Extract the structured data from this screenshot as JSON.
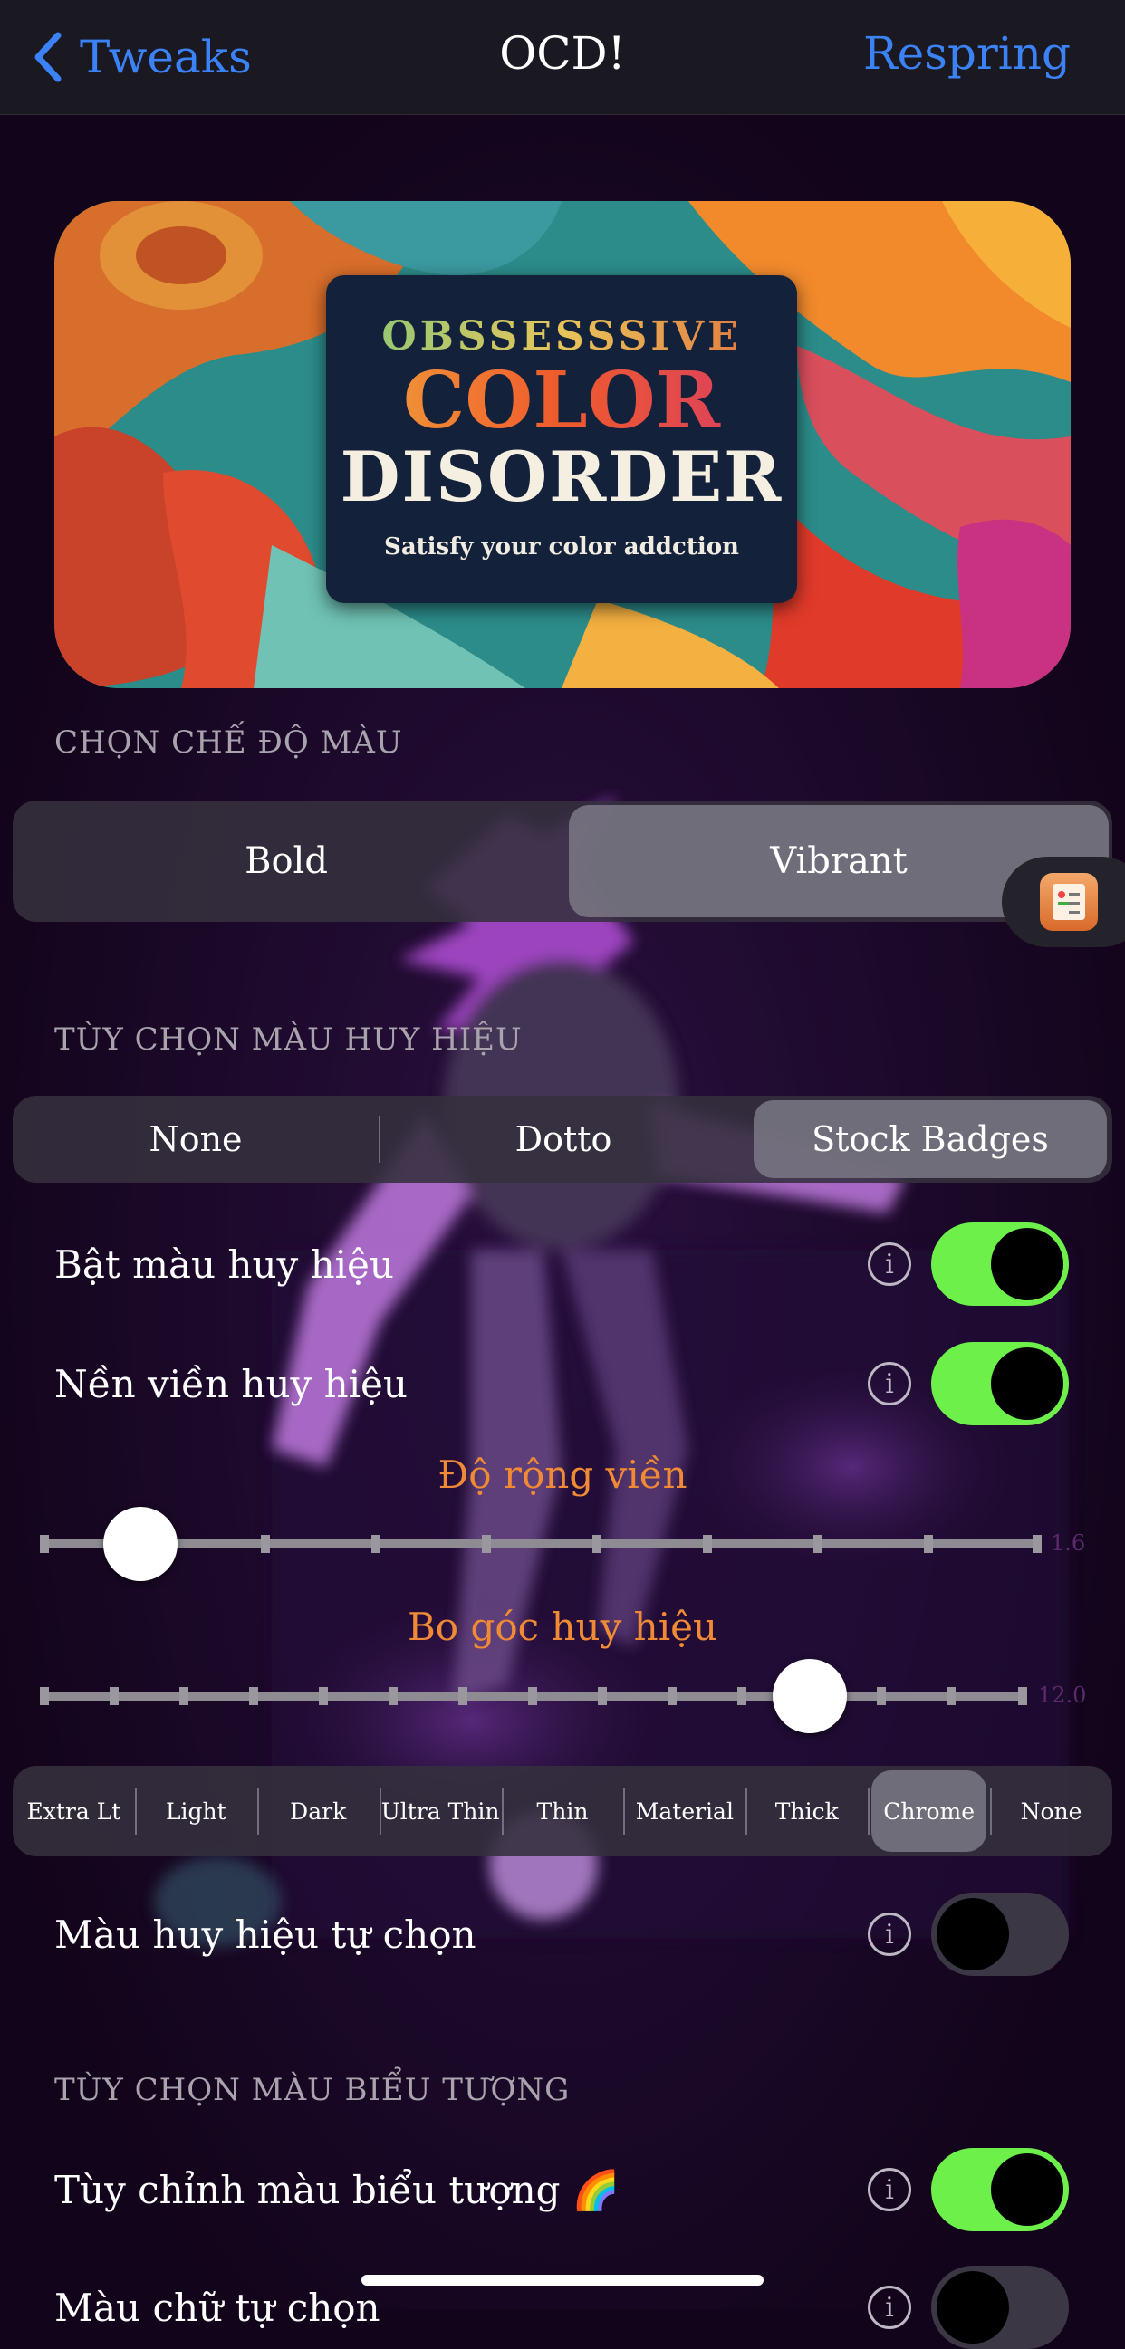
{
  "navbar": {
    "back_label": "Tweaks",
    "title": "OCD!",
    "right_label": "Respring"
  },
  "banner": {
    "line1": "OBSSESSSIVE",
    "line2": "COLOR",
    "line3": "DISORDER",
    "tagline": "Satisfy your color addction"
  },
  "color_mode": {
    "header": "CHỌN CHẾ ĐỘ MÀU",
    "options": [
      "Bold",
      "Vibrant"
    ],
    "selected": "Vibrant"
  },
  "badge_colors": {
    "header": "TÙY CHỌN MÀU HUY HIỆU",
    "options": [
      "None",
      "Dotto",
      "Stock Badges"
    ],
    "selected": "Stock Badges",
    "enable_badge_color": {
      "label": "Bật màu huy hiệu",
      "on": true
    },
    "badge_border_bg": {
      "label": "Nền viền huy hiệu",
      "on": true
    },
    "border_width": {
      "title": "Độ rộng viền",
      "value_text": "1.6",
      "fraction": 0.1
    },
    "badge_corner": {
      "title": "Bo góc huy hiệu",
      "value_text": "12.0",
      "fraction": 0.78
    },
    "materials": [
      "Extra Lt",
      "Light",
      "Dark",
      "Ultra Thin",
      "Thin",
      "Material",
      "Thick",
      "Chrome",
      "None"
    ],
    "selected_material": "Chrome",
    "custom_badge_color": {
      "label": "Màu huy hiệu tự chọn",
      "on": false
    }
  },
  "icon_colors": {
    "header": "TÙY CHỌN MÀU BIỂU TƯỢNG",
    "customize_icon_color": {
      "label": "Tùy chỉnh màu biểu tượng 🌈",
      "on": true
    },
    "custom_text_color": {
      "label": "Màu chữ tự chọn",
      "on": false
    }
  },
  "colors": {
    "accent_blue": "#3b82f6",
    "toggle_on": "#6ef04a",
    "slider_title": "#f08a35"
  }
}
